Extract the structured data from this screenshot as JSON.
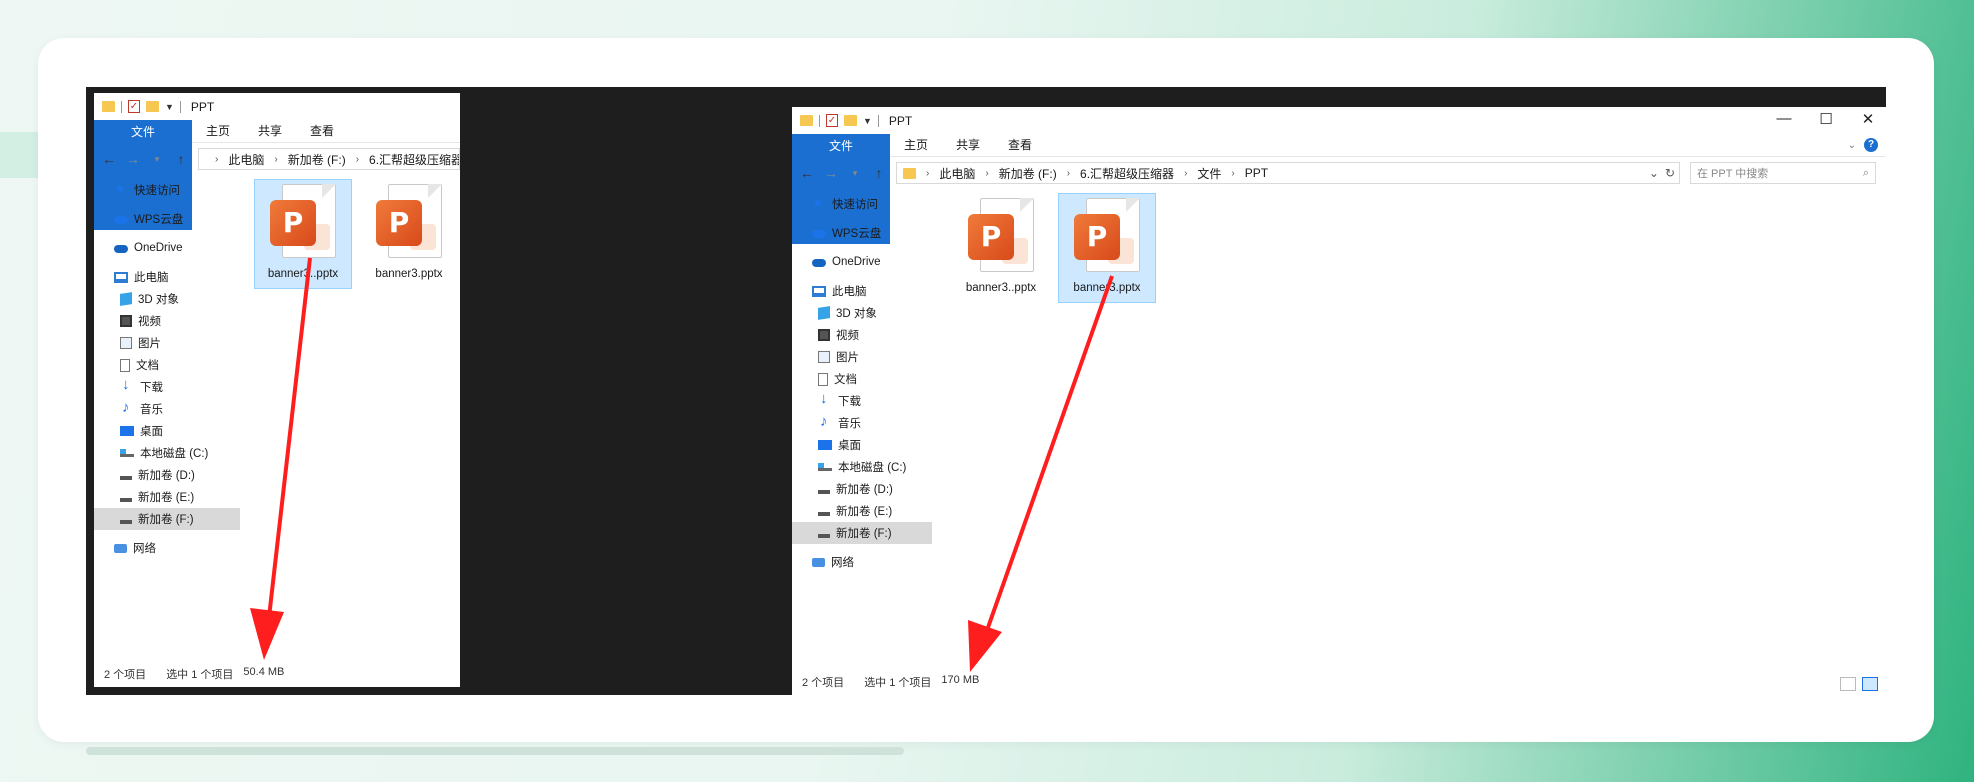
{
  "left": {
    "title": "PPT",
    "ribbon": [
      "文件",
      "主页",
      "共享",
      "查看"
    ],
    "breadcrumb": [
      "此电脑",
      "新加卷 (F:)",
      "6.汇帮超级压缩器"
    ],
    "nav": {
      "quick_access": "快速访问",
      "wps_cloud": "WPS云盘",
      "onedrive": "OneDrive",
      "this_pc": "此电脑",
      "objects_3d": "3D 对象",
      "videos": "视频",
      "pictures": "图片",
      "documents": "文档",
      "downloads": "下载",
      "music": "音乐",
      "desktop": "桌面",
      "drive_c": "本地磁盘 (C:)",
      "drive_d": "新加卷 (D:)",
      "drive_e": "新加卷 (E:)",
      "drive_f": "新加卷 (F:)",
      "network": "网络"
    },
    "files": [
      {
        "name": "banner3..pptx",
        "selected": true
      },
      {
        "name": "banner3.pptx",
        "selected": false
      }
    ],
    "status": {
      "count": "2 个项目",
      "selected": "选中 1 个项目",
      "size": "50.4 MB"
    }
  },
  "right": {
    "title": "PPT",
    "window_controls": {
      "minimize": "—",
      "maximize": "☐",
      "close": "✕"
    },
    "ribbon": [
      "文件",
      "主页",
      "共享",
      "查看"
    ],
    "breadcrumb": [
      "此电脑",
      "新加卷 (F:)",
      "6.汇帮超级压缩器",
      "文件",
      "PPT"
    ],
    "search_placeholder": "在 PPT 中搜索",
    "nav": {
      "quick_access": "快速访问",
      "wps_cloud": "WPS云盘",
      "onedrive": "OneDrive",
      "this_pc": "此电脑",
      "objects_3d": "3D 对象",
      "videos": "视频",
      "pictures": "图片",
      "documents": "文档",
      "downloads": "下载",
      "music": "音乐",
      "desktop": "桌面",
      "drive_c": "本地磁盘 (C:)",
      "drive_d": "新加卷 (D:)",
      "drive_e": "新加卷 (E:)",
      "drive_f": "新加卷 (F:)",
      "network": "网络"
    },
    "files": [
      {
        "name": "banner3..pptx",
        "selected": false
      },
      {
        "name": "banner3.pptx",
        "selected": true
      }
    ],
    "status": {
      "count": "2 个项目",
      "selected": "选中 1 个项目",
      "size": "170 MB"
    }
  },
  "colors": {
    "accent": "#1a6fd1",
    "arrow": "#ff1e1e",
    "selection": "#cde8ff",
    "ppt": "#e8602a"
  }
}
